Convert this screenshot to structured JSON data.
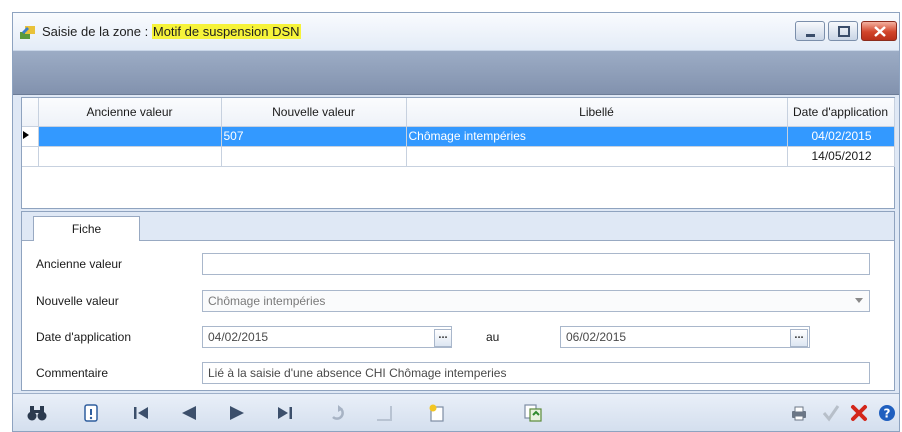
{
  "window": {
    "title_prefix": "Saisie de la zone : ",
    "title_highlight": "Motif de suspension DSN"
  },
  "grid": {
    "columns": [
      "Ancienne valeur",
      "Nouvelle valeur",
      "Libellé",
      "Date d'application"
    ],
    "rows": [
      {
        "ancienne": "",
        "nouvelle": "507",
        "libelle": "Chômage intempéries",
        "date": "04/02/2015",
        "selected": true
      },
      {
        "ancienne": "",
        "nouvelle": "",
        "libelle": "",
        "date": "14/05/2012",
        "selected": false
      }
    ]
  },
  "tabs": {
    "fiche": "Fiche"
  },
  "form": {
    "ancienne_label": "Ancienne valeur",
    "ancienne_value": "",
    "nouvelle_label": "Nouvelle valeur",
    "nouvelle_value": "Chômage intempéries",
    "date_label": "Date d'application",
    "date_from": "04/02/2015",
    "au_label": "au",
    "date_to": "06/02/2015",
    "ellipsis": "...",
    "commentaire_label": "Commentaire",
    "commentaire_value": "Lié à la saisie d'une absence CHI Chômage intemperies"
  },
  "toolbar": {
    "icons": [
      "binoculars-icon",
      "filter-icon",
      "first-record-icon",
      "previous-record-icon",
      "next-record-icon",
      "last-record-icon",
      "undo-icon",
      "blank-icon",
      "new-record-icon",
      "copy-record-icon",
      "print-icon",
      "validate-icon",
      "delete-icon",
      "help-icon"
    ]
  },
  "colors": {
    "selection": "#3399ff",
    "title_highlight": "#f6f33a",
    "header_bar": "#8f9fb9",
    "window_bg": "#dfe8f5"
  }
}
